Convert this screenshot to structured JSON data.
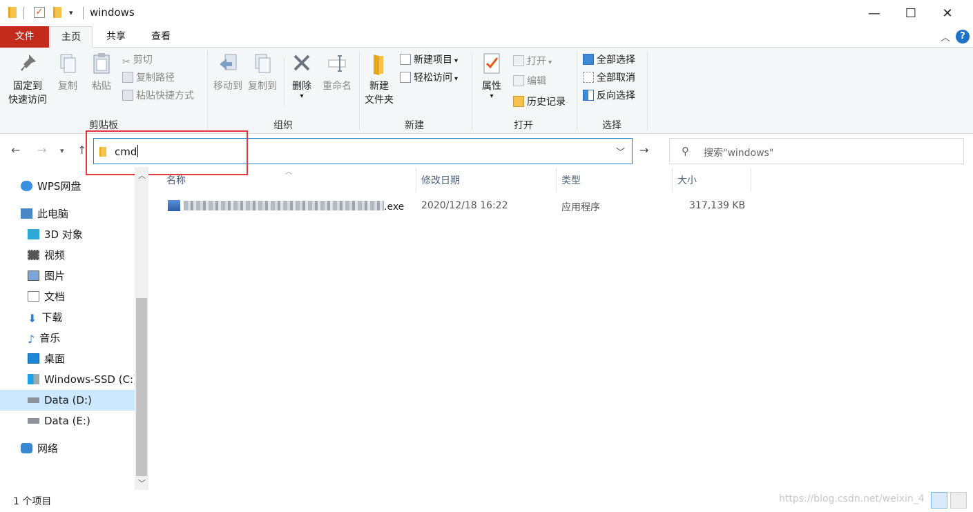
{
  "window": {
    "title": "windows",
    "minimize": "—",
    "maximize": "☐",
    "close": "✕"
  },
  "tabs": [
    "文件",
    "主页",
    "共享",
    "查看"
  ],
  "active_tab": "主页",
  "ribbon": {
    "clipboard": {
      "label": "剪贴板",
      "pin_line1": "固定到",
      "pin_line2": "快速访问",
      "copy": "复制",
      "paste": "粘贴",
      "cut": "剪切",
      "copy_path": "复制路径",
      "paste_shortcut": "粘贴快捷方式"
    },
    "organize": {
      "label": "组织",
      "move_to": "移动到",
      "copy_to": "复制到",
      "delete": "删除",
      "rename": "重命名"
    },
    "new": {
      "label": "新建",
      "new_folder_line1": "新建",
      "new_folder_line2": "文件夹",
      "new_item": "新建项目",
      "easy_access": "轻松访问"
    },
    "open": {
      "label": "打开",
      "properties": "属性",
      "open": "打开",
      "edit": "编辑",
      "history": "历史记录"
    },
    "select": {
      "label": "选择",
      "select_all": "全部选择",
      "select_none": "全部取消",
      "invert": "反向选择"
    }
  },
  "address": {
    "value": "cmd",
    "search_placeholder": "搜索\"windows\""
  },
  "nav": {
    "items": [
      {
        "label": "WPS网盘",
        "icon": "cloud-icon"
      },
      {
        "label": "此电脑",
        "icon": "computer-icon"
      },
      {
        "label": "3D 对象",
        "icon": "cube-icon"
      },
      {
        "label": "视频",
        "icon": "video-icon"
      },
      {
        "label": "图片",
        "icon": "picture-icon"
      },
      {
        "label": "文档",
        "icon": "document-icon"
      },
      {
        "label": "下载",
        "icon": "download-icon"
      },
      {
        "label": "音乐",
        "icon": "music-icon"
      },
      {
        "label": "桌面",
        "icon": "desktop-icon"
      },
      {
        "label": "Windows-SSD (C:)",
        "icon": "drive-icon"
      },
      {
        "label": "Data (D:)",
        "icon": "drive-icon"
      },
      {
        "label": "Data (E:)",
        "icon": "drive-icon"
      },
      {
        "label": "网络",
        "icon": "network-icon"
      }
    ],
    "selected": "Data (D:)"
  },
  "columns": [
    "名称",
    "修改日期",
    "类型",
    "大小"
  ],
  "files": [
    {
      "name_suffix": ".exe",
      "modified": "2020/12/18 16:22",
      "type": "应用程序",
      "size": "317,139 KB"
    }
  ],
  "status": {
    "count": "1 个项目",
    "watermark": "https://blog.csdn.net/weixin_4"
  },
  "colors": {
    "file_tab": "#c42b1c",
    "address_border": "#1883d7",
    "highlight": "#e3393c",
    "selected_nav": "#cce8ff"
  }
}
